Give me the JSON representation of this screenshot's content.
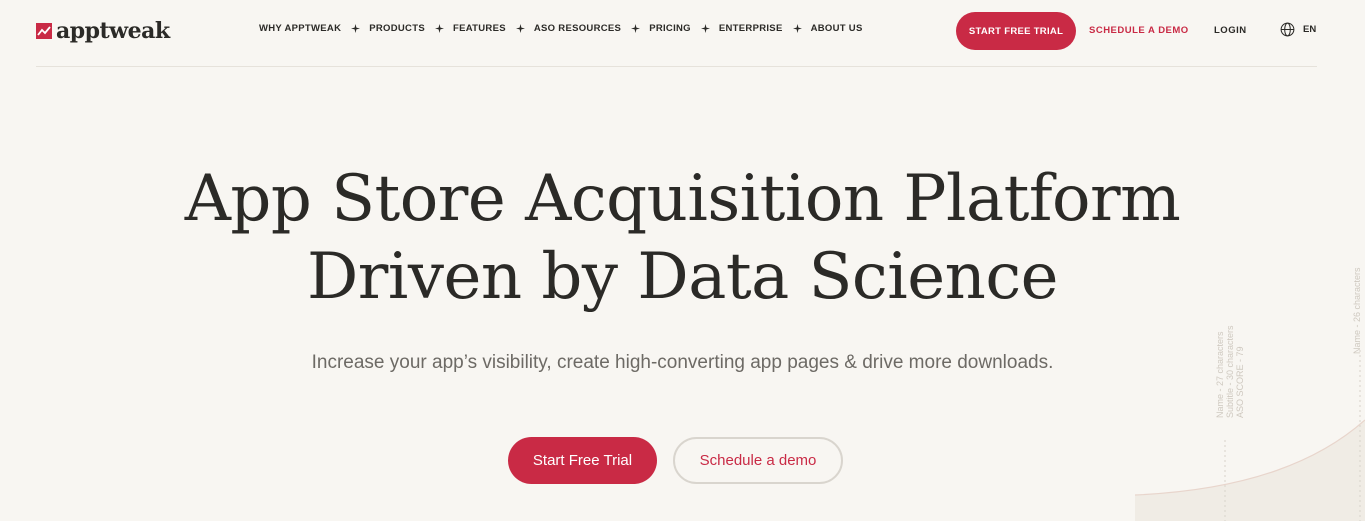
{
  "brand": {
    "name": "apptweak",
    "accent": "#c92a45"
  },
  "nav": {
    "items": [
      {
        "label": "WHY APPTWEAK"
      },
      {
        "label": "PRODUCTS"
      },
      {
        "label": "FEATURES"
      },
      {
        "label": "ASO RESOURCES"
      },
      {
        "label": "PRICING"
      },
      {
        "label": "ENTERPRISE"
      },
      {
        "label": "ABOUT US"
      }
    ],
    "trial_label": "START FREE TRIAL",
    "demo_label": "SCHEDULE A DEMO",
    "login_label": "LOGIN",
    "language": "EN"
  },
  "hero": {
    "title_line1": "App Store Acquisition Platform",
    "title_line2": "Driven by Data Science",
    "subtitle": "Increase your app’s visibility, create high-converting app pages & drive more downloads.",
    "primary_cta": "Start Free Trial",
    "secondary_cta": "Schedule a demo"
  },
  "decoration": {
    "label_a": "Name - 27 characters",
    "label_b": "Subtitle - 30 characters",
    "label_c": "ASO SCORE - 79",
    "label_d": "Name - 26 characters"
  }
}
